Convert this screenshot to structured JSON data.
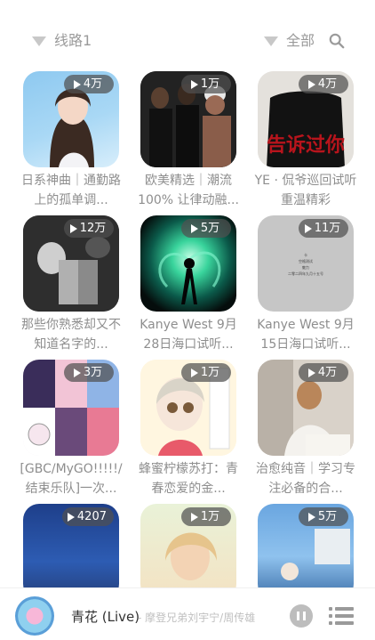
{
  "topbar": {
    "route_label": "线路1",
    "filter_label": "全部"
  },
  "cards": [
    {
      "title": "日系神曲｜通勤路上的孤单调...",
      "plays": "4万"
    },
    {
      "title": "欧美精选｜潮流100% 让律动融...",
      "plays": "1万"
    },
    {
      "title": "YE · 侃爷巡回试听 重温精彩",
      "plays": "4万"
    },
    {
      "title": "那些你熟悉却又不知道名字的...",
      "plays": "12万"
    },
    {
      "title": "Kanye West 9月28日海口试听...",
      "plays": "5万"
    },
    {
      "title": "Kanye West 9月15日海口试听...",
      "plays": "11万"
    },
    {
      "title": "[GBC/MyGO!!!!!/结束乐队]一次...",
      "plays": "3万"
    },
    {
      "title": "蜂蜜柠檬苏打：青春恋爱的金...",
      "plays": "1万"
    },
    {
      "title": "治愈纯音｜学习专注必备的合...",
      "plays": "4万"
    },
    {
      "title": "",
      "plays": "4207"
    },
    {
      "title": "",
      "plays": "1万"
    },
    {
      "title": "",
      "plays": "5万"
    }
  ],
  "cover_texts": {
    "c3": "告诉过你",
    "c6_lines": [
      "卡",
      "空格测试",
      "魅力",
      "二零二四年九月十五号"
    ]
  },
  "player": {
    "song": "青花 (Live)",
    "artist": "- 摩登兄弟刘宇宁/周传雄"
  },
  "colors": {
    "badge_bg": "#505050",
    "title_text": "#8e8e8e",
    "icon_gray": "#c8c8c8"
  }
}
